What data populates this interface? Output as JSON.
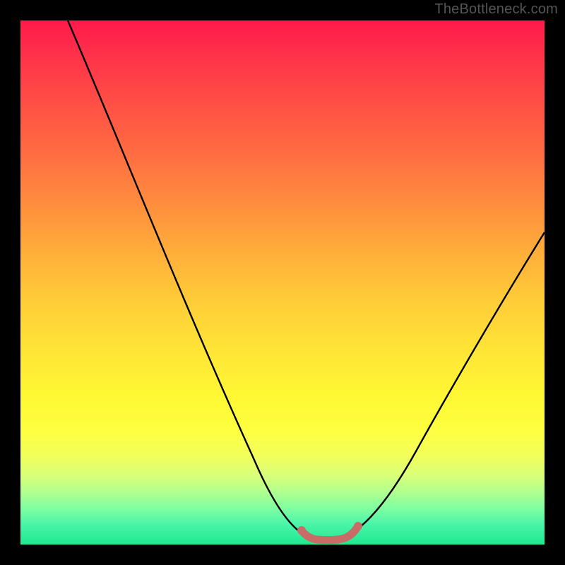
{
  "watermark": "TheBottleneck.com",
  "chart_data": {
    "type": "line",
    "title": "",
    "xlabel": "",
    "ylabel": "",
    "xlim": [
      0,
      100
    ],
    "ylim": [
      0,
      100
    ],
    "series": [
      {
        "name": "bottleneck-curve",
        "x": [
          9,
          15,
          22,
          28,
          34,
          40,
          45,
          50,
          54,
          56,
          58,
          60,
          62,
          66,
          70,
          75,
          80,
          86,
          92,
          100
        ],
        "y": [
          100,
          88,
          75,
          62,
          49,
          36,
          24,
          12,
          4,
          1,
          0,
          0,
          1,
          4,
          10,
          18,
          27,
          36,
          46,
          60
        ]
      },
      {
        "name": "bottom-band",
        "x": [
          54,
          56,
          58,
          60,
          62,
          64
        ],
        "y": [
          2.2,
          1.3,
          0.9,
          0.9,
          1.3,
          2.7
        ]
      }
    ],
    "gradient_stops": [
      {
        "pos": 0,
        "color": "#ff1a4b"
      },
      {
        "pos": 50,
        "color": "#ffcc38"
      },
      {
        "pos": 80,
        "color": "#feff3f"
      },
      {
        "pos": 100,
        "color": "#1de990"
      }
    ],
    "band_color": "#c96b67"
  }
}
